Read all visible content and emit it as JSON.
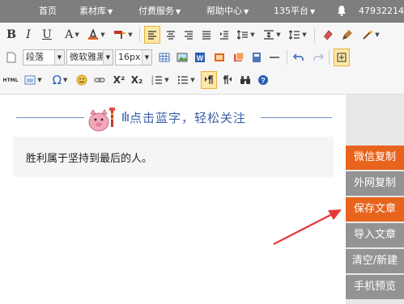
{
  "nav": {
    "items": [
      {
        "label": "首页",
        "dropdown": false
      },
      {
        "label": "素材库",
        "dropdown": true
      },
      {
        "label": "付费服务",
        "dropdown": true
      },
      {
        "label": "帮助中心",
        "dropdown": true
      },
      {
        "label": "135平台",
        "dropdown": true
      }
    ],
    "phone": "47932214"
  },
  "toolbar": {
    "row1_icons": [
      "bold-icon",
      "italic-icon",
      "underline-icon",
      "font-color-icon",
      "background-color-icon",
      "format-painter-icon",
      "align-left-icon",
      "align-center-icon",
      "align-right-icon",
      "align-justify-icon",
      "indent-icon",
      "line-height-icon",
      "paragraph-spacing-icon",
      "list-spacing-icon",
      "eraser-icon",
      "brush-icon",
      "magic-wand-icon"
    ],
    "bold_label": "B",
    "italic_label": "I",
    "underline_label": "U",
    "font_color_label": "A",
    "paragraph_select": "段落",
    "font_select": "微软雅黑",
    "size_select": "16px",
    "symbol_label": "Ω",
    "superscript_label": "X²",
    "subscript_label": "X₂",
    "html_label": "HTML"
  },
  "editor": {
    "banner_text": "点击蓝字，轻松关注",
    "body_text": "胜利属于坚持到最后的人。"
  },
  "sidebar": {
    "buttons": [
      {
        "label": "微信复制",
        "accent": true
      },
      {
        "label": "外网复制",
        "accent": false
      },
      {
        "label": "保存文章",
        "accent": true
      },
      {
        "label": "导入文章",
        "accent": false
      },
      {
        "label": "清空/新建",
        "accent": false
      },
      {
        "label": "手机预览",
        "accent": false
      }
    ]
  },
  "colors": {
    "accent": "#e8631c",
    "nav_bg": "#7e7e7e",
    "button_gray": "#939393",
    "banner_blue": "#3c5fa8",
    "arrow_red": "#e53935"
  }
}
